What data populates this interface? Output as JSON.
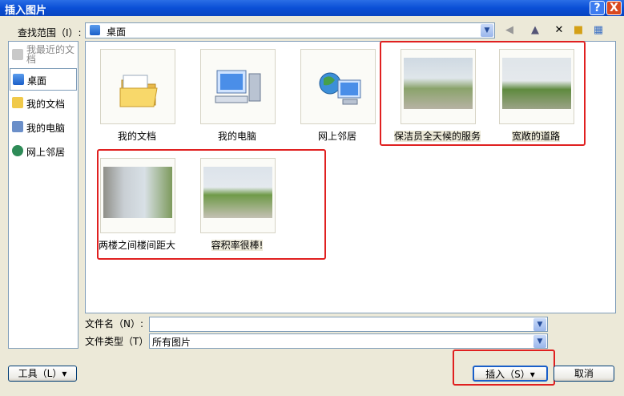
{
  "window": {
    "title": "插入图片",
    "help": "?",
    "close": "X"
  },
  "toolbar": {
    "lookin_label": "查找范围（I）:",
    "lookin_value": "桌面"
  },
  "places": [
    {
      "label": "我最近的文档"
    },
    {
      "label": "桌面"
    },
    {
      "label": "我的文档"
    },
    {
      "label": "我的电脑"
    },
    {
      "label": "网上邻居"
    }
  ],
  "files": [
    {
      "name": "我的文档",
      "icon": "folder-icon"
    },
    {
      "name": "我的电脑",
      "icon": "computer-icon"
    },
    {
      "name": "网上邻居",
      "icon": "network-icon"
    },
    {
      "name": "保洁员全天候的服务",
      "icon": "photo"
    },
    {
      "name": "宽敞的道路",
      "icon": "photo"
    },
    {
      "name": "两楼之间楼间距大",
      "icon": "photo"
    },
    {
      "name": "容积率很棒!",
      "icon": "photo"
    }
  ],
  "form": {
    "filename_label": "文件名（N）:",
    "filename_value": "",
    "filetype_label": "文件类型（T）:",
    "filetype_value": "所有图片"
  },
  "buttons": {
    "tools": "工具（L）▾",
    "insert": "插入（S）▾",
    "cancel": "取消"
  },
  "colors": {
    "highlight": "#e02020",
    "title_bar": "#0a4fd6"
  }
}
